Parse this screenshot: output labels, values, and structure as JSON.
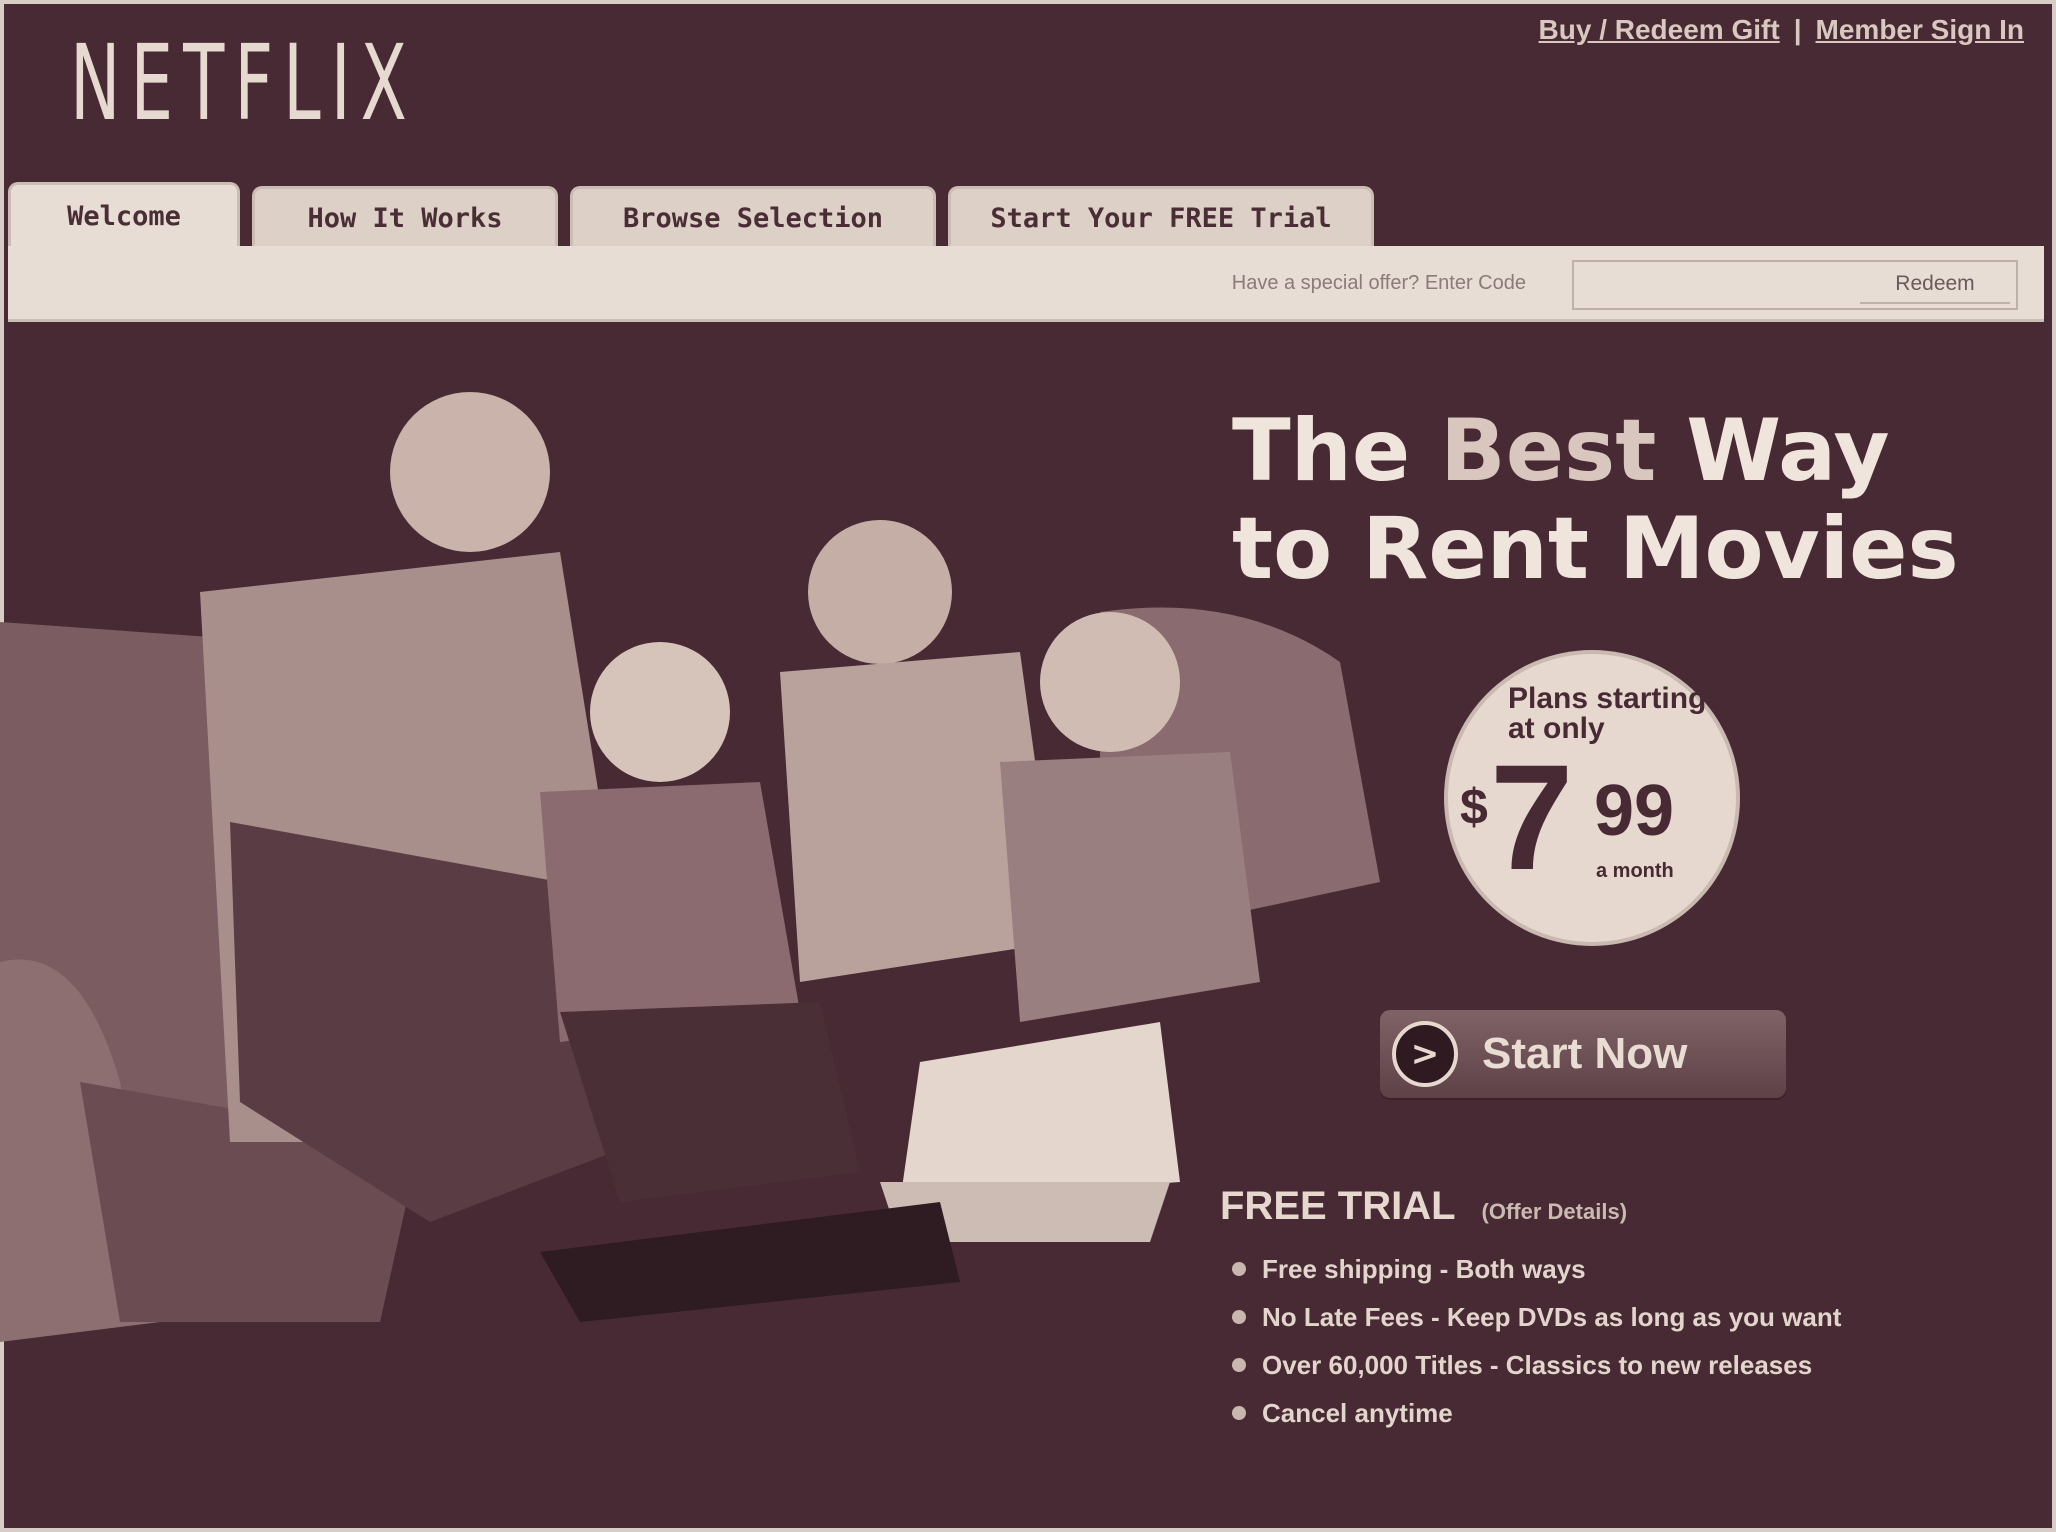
{
  "brand": {
    "logo": "NETFLIX"
  },
  "top_links": {
    "buy_redeem": "Buy / Redeem Gift",
    "separator": "|",
    "sign_in": "Member Sign In"
  },
  "tabs": [
    {
      "label": "Welcome",
      "active": true
    },
    {
      "label": "How It Works",
      "active": false
    },
    {
      "label": "Browse Selection",
      "active": false
    },
    {
      "label": "Start Your FREE Trial",
      "active": false
    }
  ],
  "offer_bar": {
    "prompt": "Have a special offer? Enter Code",
    "input_value": "",
    "redeem_label": "Redeem"
  },
  "hero": {
    "headline_part1": "The ",
    "headline_best": "Best",
    "headline_part2": " Way",
    "headline_line2": "to Rent Movies"
  },
  "price_badge": {
    "plans_text": "Plans starting at only",
    "dollar_sign": "$",
    "dollars": "7",
    "cents": "99",
    "period": "a month"
  },
  "cta": {
    "label": "Start Now",
    "icon": "play-arrow-icon"
  },
  "free_trial": {
    "title": "FREE TRIAL",
    "offer_details": "(Offer Details)",
    "bullets": [
      "Free shipping - Both ways",
      "No Late Fees - Keep DVDs as long as you want",
      "Over 60,000 Titles - Classics to new releases",
      "Cancel anytime"
    ]
  },
  "colors": {
    "background": "#472a33",
    "tab": "#ddd0c7",
    "text_light": "#e9ddd4"
  }
}
